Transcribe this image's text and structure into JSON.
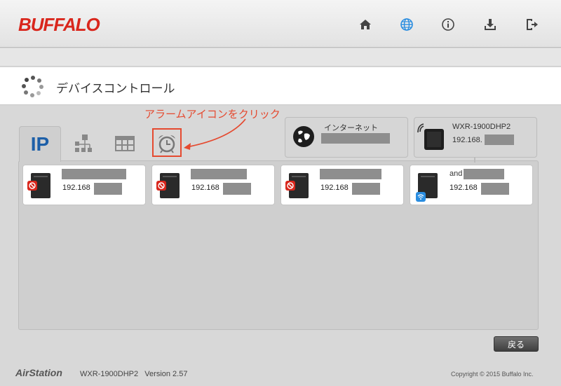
{
  "header": {
    "logo": "BUFFALO",
    "icons": [
      "home-icon",
      "globe-icon",
      "info-icon",
      "download-icon",
      "logout-icon"
    ]
  },
  "title": {
    "text": "デバイスコントロール"
  },
  "annotation": {
    "text": "アラームアイコンをクリック",
    "color": "#e54a30"
  },
  "tabs": [
    {
      "label": "IP",
      "icon": "ip-text",
      "active": true
    },
    {
      "label": "",
      "icon": "network-map-icon"
    },
    {
      "label": "",
      "icon": "grid-icon"
    },
    {
      "label": "",
      "icon": "alarm-icon",
      "highlighted": true
    }
  ],
  "status": {
    "internet": {
      "label": "インターネット"
    },
    "router": {
      "model": "WXR-1900DHP2",
      "ip": "192.168."
    }
  },
  "devices": [
    {
      "ip": "192.168",
      "blocked": true,
      "name": ""
    },
    {
      "ip": "192.168",
      "blocked": true,
      "name": ""
    },
    {
      "ip": "192.168",
      "blocked": true,
      "name": ""
    },
    {
      "ip": "192.168",
      "blocked": false,
      "wifi": true,
      "name": "and"
    }
  ],
  "buttons": {
    "back": "戻る"
  },
  "footer": {
    "brand": "AirStation",
    "model_version": "WXR-1900DHP2   Version 2.57",
    "copyright": "Copyright © 2015 Buffalo Inc."
  }
}
